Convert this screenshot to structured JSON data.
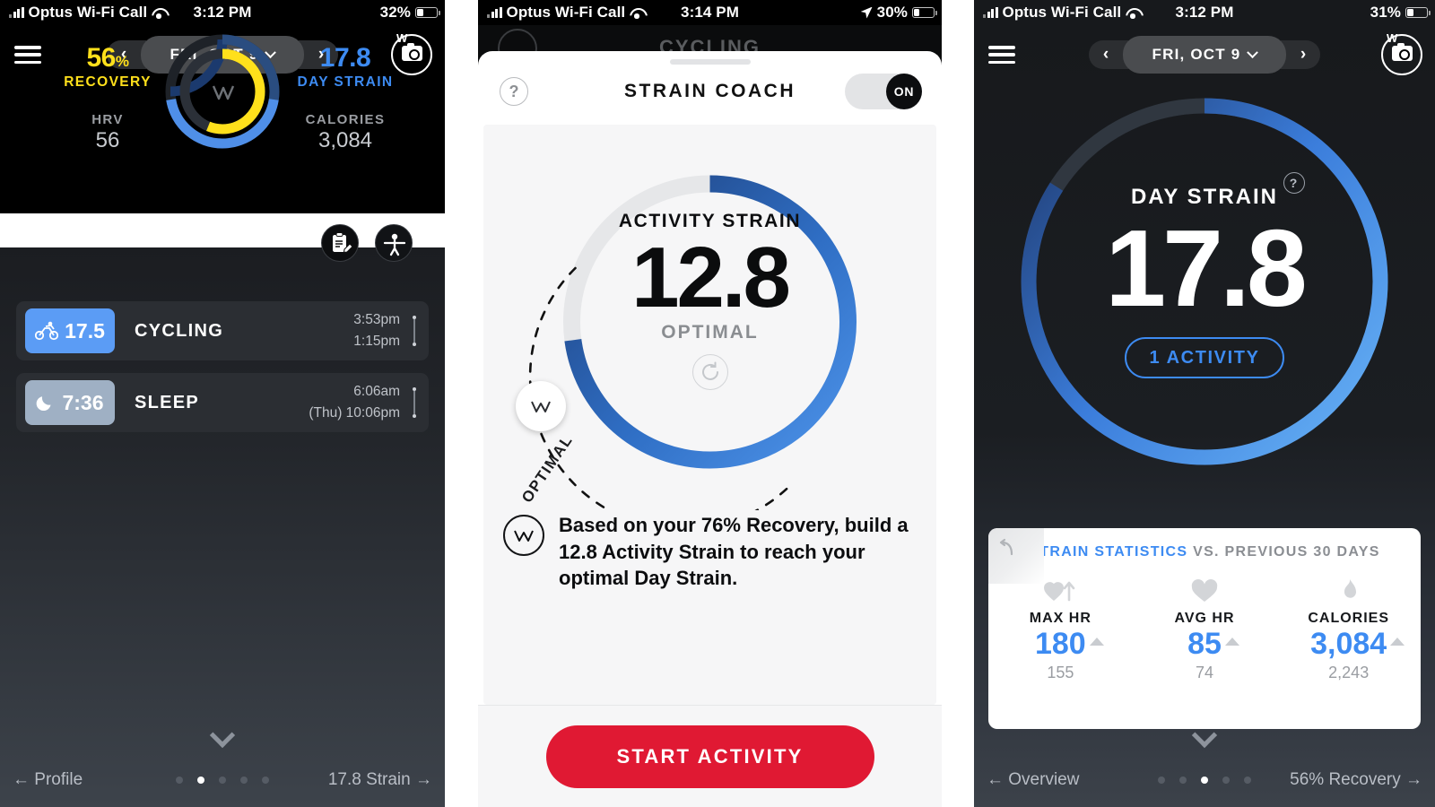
{
  "panel1": {
    "status": {
      "carrier": "Optus Wi-Fi Call",
      "time": "3:12 PM",
      "battery": "32%"
    },
    "nav": {
      "date": "FRI, OCT 9",
      "prev_icon": "chevron-left-icon",
      "next_icon": "chevron-right-icon",
      "menu_icon": "hamburger-icon",
      "camera_icon": "camera-icon"
    },
    "hero": {
      "recovery_value": "56",
      "recovery_pct": "%",
      "recovery_label": "RECOVERY",
      "hrv_label": "HRV",
      "hrv_value": "56",
      "strain_value": "17.8",
      "strain_label": "DAY STRAIN",
      "calories_label": "CALORIES",
      "calories_value": "3,084"
    },
    "fabs": {
      "journal_icon": "clipboard-edit-icon",
      "add_activity_icon": "person-plus-icon",
      "plus": "+"
    },
    "activities": [
      {
        "score": "17.5",
        "name": "CYCLING",
        "icon": "cycling-icon",
        "end_time": "3:53pm",
        "start_time": "1:15pm",
        "chip": "blue"
      },
      {
        "score": "7:36",
        "name": "SLEEP",
        "icon": "moon-icon",
        "end_time": "6:06am",
        "start_time": "(Thu) 10:06pm",
        "chip": "grey"
      }
    ],
    "bottom": {
      "left": "← Profile",
      "right": "17.8 Strain →",
      "active_dot": 1,
      "dot_count": 5,
      "chevron_icon": "chevron-down-icon"
    }
  },
  "panel2": {
    "status": {
      "carrier": "Optus Wi-Fi Call",
      "time": "3:14 PM",
      "battery": "30%",
      "location_icon": "location-arrow-icon"
    },
    "ghost_header": "CYCLING",
    "sheet": {
      "help_icon": "question-mark-icon",
      "help_label": "?",
      "title": "STRAIN COACH",
      "toggle_label": "ON",
      "toggle_state": "on",
      "ring": {
        "label": "ACTIVITY STRAIN",
        "value": "12.8",
        "status": "OPTIMAL",
        "reset_icon": "reset-icon",
        "marker_icon": "whoop-logo-icon",
        "arc_label": "OPTIMAL"
      },
      "note": "Based on your 76% Recovery, build a 12.8 Activity Strain to reach your optimal Day Strain.",
      "note_icon": "whoop-logo-icon",
      "cta": "START ACTIVITY"
    }
  },
  "panel3": {
    "status": {
      "carrier": "Optus Wi-Fi Call",
      "time": "3:12 PM",
      "battery": "31%"
    },
    "nav": {
      "date": "FRI, OCT 9",
      "menu_icon": "hamburger-icon",
      "camera_icon": "camera-icon"
    },
    "ring": {
      "label": "DAY STRAIN",
      "help_label": "?",
      "value": "17.8",
      "activity_pill": "1 ACTIVITY"
    },
    "stats": {
      "title_a": "STRAIN STATISTICS",
      "title_b": "VS. PREVIOUS 30 DAYS",
      "fold_icon": "curved-arrow-icon",
      "columns": [
        {
          "icon": "heart-up-icon",
          "label": "MAX HR",
          "value": "180",
          "prev": "155",
          "trend": "up"
        },
        {
          "icon": "heart-icon",
          "label": "AVG HR",
          "value": "85",
          "prev": "74",
          "trend": "up"
        },
        {
          "icon": "flame-icon",
          "label": "CALORIES",
          "value": "3,084",
          "prev": "2,243",
          "trend": "up"
        }
      ]
    },
    "bottom": {
      "left": "← Overview",
      "right": "56% Recovery →",
      "active_dot": 2,
      "dot_count": 5,
      "chevron_icon": "chevron-down-icon"
    }
  },
  "colors": {
    "strain_blue": "#3d8bf2",
    "recovery_yellow": "#ffe01b",
    "cta_red": "#e01933",
    "dark_bg": "#0b0c0d",
    "sheet_bg": "#f6f6f7"
  }
}
